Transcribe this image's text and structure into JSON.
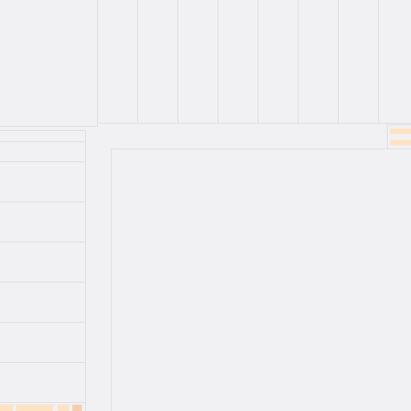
{
  "colors": {
    "background": "#f1f1f4",
    "grid": "#dcdce2",
    "accent": "#fde3c4"
  }
}
